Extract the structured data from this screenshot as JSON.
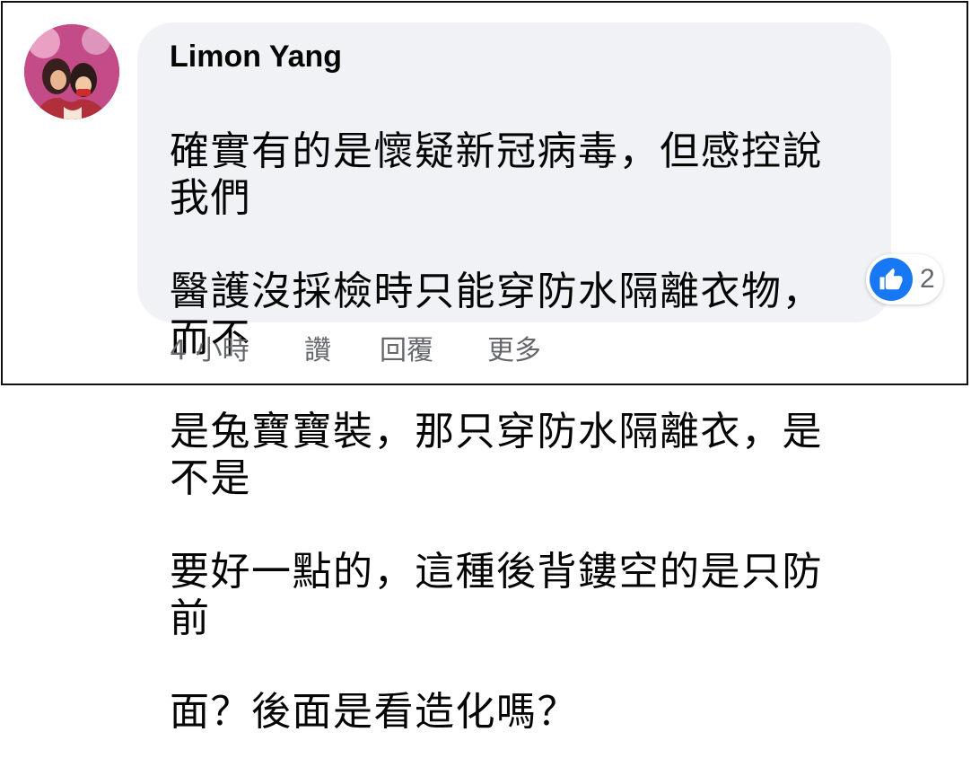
{
  "comment": {
    "author": "Limon Yang",
    "text_lines": [
      "確實有的是懷疑新冠病毒，但感控說我們",
      "醫護沒採檢時只能穿防水隔離衣物，而不",
      "是兔寶寶裝，那只穿防水隔離衣，是不是",
      "要好一點的，這種後背鏤空的是只防前",
      "面？後面是看造化嗎？"
    ]
  },
  "reactions": {
    "icon": "like-icon",
    "count": "2"
  },
  "actions": {
    "time": "4 小時",
    "like": "讚",
    "reply": "回覆",
    "more": "更多"
  },
  "colors": {
    "bubble": "#f0f2f5",
    "like_blue": "#1877f2",
    "meta_gray": "#65676b"
  }
}
